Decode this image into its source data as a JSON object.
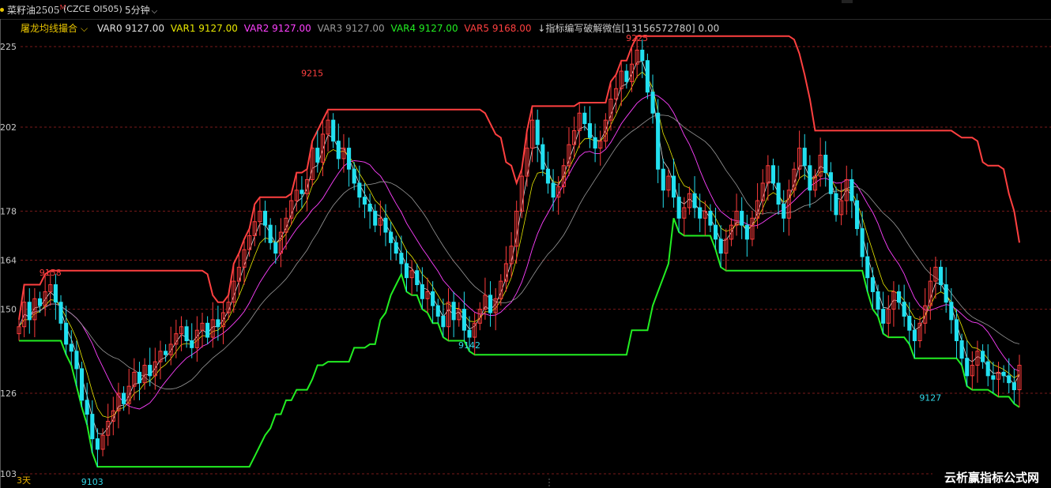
{
  "header": {
    "symbol": "菜籽油2505",
    "symbol_flag": "M",
    "code": "(CZCE OI505)",
    "period": "5分钟",
    "period_icon": "chevron-down-icon"
  },
  "legend": {
    "indicator_name": "屠龙均线撮合",
    "items": [
      {
        "label": "VAR0 9127.00",
        "color": "#e0e0e0"
      },
      {
        "label": "VAR1 9127.00",
        "color": "#e8e800"
      },
      {
        "label": "VAR2 9127.00",
        "color": "#ff40ff"
      },
      {
        "label": "VAR3 9127.00",
        "color": "#9a9a9a"
      },
      {
        "label": "VAR4 9127.00",
        "color": "#22ee22"
      },
      {
        "label": "VAR5 9168.00",
        "color": "#ff4040"
      }
    ],
    "note": "↓指标编写破解微信[13156572780] 0.00"
  },
  "footer": {
    "days_label": "3天",
    "watermark": "云析赢指标公式网"
  },
  "chart_data": {
    "type": "candlestick",
    "y_tick_labels": [
      "225",
      "202",
      "178",
      "164",
      "150",
      "126",
      "103"
    ],
    "y_tick_values": [
      9225,
      9202,
      9178,
      9164,
      9150,
      9126,
      9103
    ],
    "ylim": [
      9103,
      9225
    ],
    "annotations": [
      {
        "text": "9158",
        "bar": 6,
        "value": 9158,
        "color": "#ff4040",
        "pos": "above"
      },
      {
        "text": "9103",
        "bar": 14,
        "value": 9103,
        "color": "#33d8e8",
        "pos": "below"
      },
      {
        "text": "9215",
        "bar": 56,
        "value": 9215,
        "color": "#ff4040",
        "pos": "above"
      },
      {
        "text": "9142",
        "bar": 86,
        "value": 9142,
        "color": "#33d8e8",
        "pos": "below"
      },
      {
        "text": "9225",
        "bar": 118,
        "value": 9225,
        "color": "#ff4040",
        "pos": "above"
      },
      {
        "text": "9127",
        "bar": 174,
        "value": 9127,
        "color": "#33d8e8",
        "pos": "below"
      }
    ],
    "closes": [
      9145,
      9152,
      9147,
      9153,
      9151,
      9155,
      9157,
      9152,
      9146,
      9140,
      9138,
      9133,
      9124,
      9120,
      9113,
      9110,
      9114,
      9118,
      9121,
      9126,
      9123,
      9128,
      9132,
      9129,
      9134,
      9131,
      9135,
      9138,
      9137,
      9140,
      9143,
      9145,
      9141,
      9139,
      9144,
      9146,
      9142,
      9147,
      9145,
      9149,
      9152,
      9158,
      9162,
      9167,
      9171,
      9175,
      9178,
      9174,
      9169,
      9166,
      9172,
      9176,
      9181,
      9184,
      9183,
      9187,
      9196,
      9192,
      9200,
      9204,
      9198,
      9193,
      9196,
      9190,
      9186,
      9182,
      9180,
      9178,
      9174,
      9176,
      9172,
      9169,
      9166,
      9163,
      9159,
      9161,
      9157,
      9153,
      9155,
      9151,
      9148,
      9145,
      9152,
      9147,
      9150,
      9144,
      9142,
      9146,
      9150,
      9154,
      9149,
      9153,
      9158,
      9163,
      9168,
      9178,
      9188,
      9196,
      9204,
      9197,
      9190,
      9186,
      9182,
      9185,
      9191,
      9197,
      9201,
      9206,
      9203,
      9199,
      9196,
      9198,
      9204,
      9210,
      9213,
      9218,
      9215,
      9220,
      9224,
      9221,
      9212,
      9206,
      9190,
      9184,
      9188,
      9182,
      9176,
      9179,
      9183,
      9179,
      9176,
      9178,
      9174,
      9170,
      9166,
      9170,
      9174,
      9178,
      9174,
      9170,
      9176,
      9181,
      9186,
      9191,
      9186,
      9180,
      9176,
      9184,
      9190,
      9196,
      9191,
      9184,
      9188,
      9194,
      9189,
      9183,
      9177,
      9181,
      9187,
      9181,
      9173,
      9165,
      9159,
      9155,
      9150,
      9146,
      9150,
      9155,
      9152,
      9148,
      9144,
      9141,
      9146,
      9151,
      9158,
      9162,
      9157,
      9152,
      9147,
      9141,
      9136,
      9131,
      9134,
      9138,
      9135,
      9131,
      9130,
      9132,
      9131,
      9129,
      9127,
      9134
    ]
  }
}
